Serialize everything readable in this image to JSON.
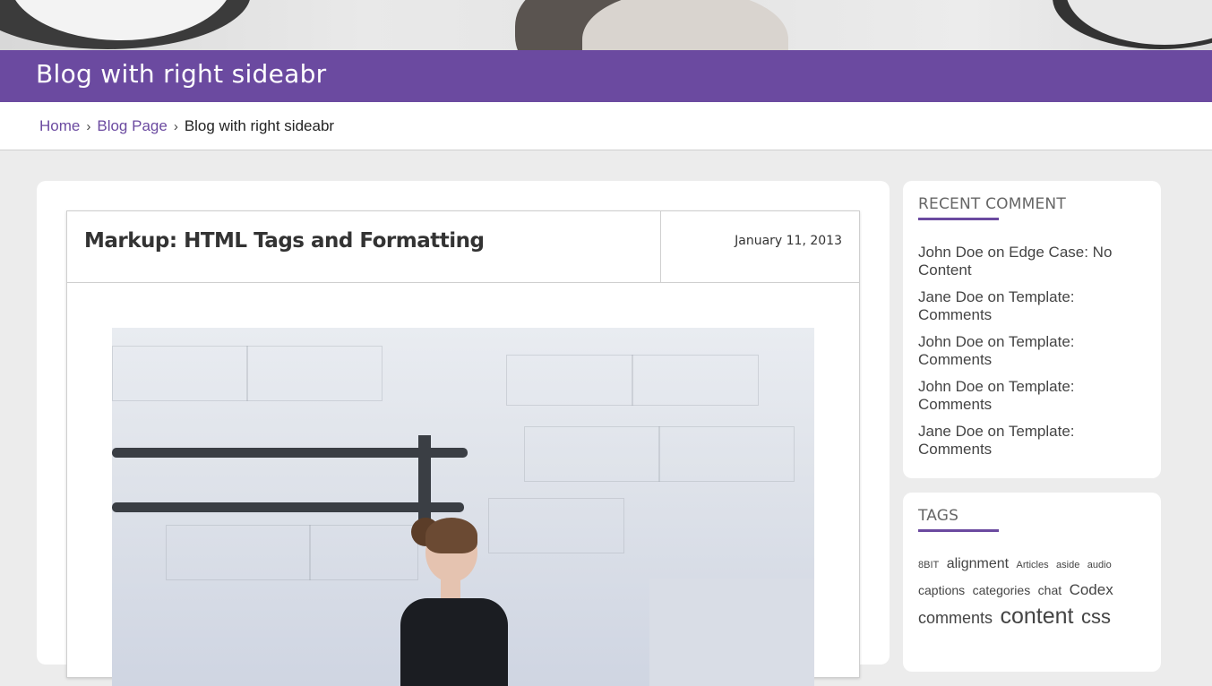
{
  "page": {
    "title": "Blog with right sideabr"
  },
  "breadcrumb": {
    "items": [
      "Home",
      "Blog Page"
    ],
    "current": "Blog with right sideabr",
    "separator": "›"
  },
  "post": {
    "title": "Markup: HTML Tags and Formatting",
    "date": "January 11, 2013"
  },
  "sidebar": {
    "recent_comments": {
      "heading": "RECENT COMMENT",
      "items": [
        "John Doe on Edge Case: No Content",
        "Jane Doe on Template: Comments",
        "John Doe on Template: Comments",
        "John Doe on Template: Comments",
        "Jane Doe on Template: Comments"
      ]
    },
    "tags": {
      "heading": "TAGS",
      "items": [
        "8BIT",
        "alignment",
        "Articles",
        "aside",
        "audio",
        "captions",
        "categories",
        "chat",
        "Codex",
        "comments",
        "content",
        "css"
      ]
    }
  },
  "colors": {
    "accent": "#6b4aa0"
  }
}
